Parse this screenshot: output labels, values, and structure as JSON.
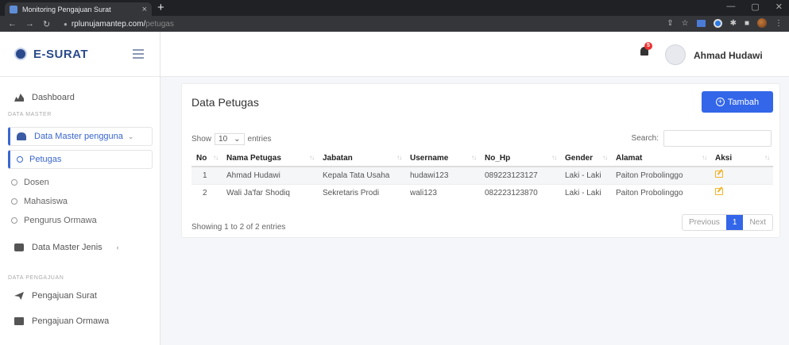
{
  "browser": {
    "tab_title": "Monitoring Pengajuan Surat",
    "tab_close": "×",
    "new_tab": "+",
    "url_domain": "rplunujamantep.com/",
    "url_path": "petugas"
  },
  "header": {
    "brand": "E-SURAT",
    "notification_count": "5",
    "user_name": "Ahmad Hudawi"
  },
  "sidebar": {
    "dashboard": "Dashboard",
    "section_master": "DATA MASTER",
    "master_users": "Data Master pengguna",
    "sub_items": [
      "Petugas",
      "Dosen",
      "Mahasiswa",
      "Pengurus Ormawa"
    ],
    "master_types": "Data Master Jenis",
    "section_submission": "DATA PENGAJUAN",
    "submission_letter": "Pengajuan Surat",
    "submission_ormawa": "Pengajuan Ormawa"
  },
  "card": {
    "title": "Data Petugas",
    "add_button": "Tambah",
    "show_label": "Show",
    "entries_value": "10",
    "entries_label": "entries",
    "search_label": "Search:",
    "columns": [
      "No",
      "Nama Petugas",
      "Jabatan",
      "Username",
      "No_Hp",
      "Gender",
      "Alamat",
      "Aksi"
    ],
    "rows": [
      [
        "1",
        "Ahmad Hudawi",
        "Kepala Tata Usaha",
        "hudawi123",
        "089223123127",
        "Laki - Laki",
        "Paiton Probolinggo"
      ],
      [
        "2",
        "Wali Ja'far Shodiq",
        "Sekretaris Prodi",
        "wali123",
        "082223123870",
        "Laki - Laki",
        "Paiton Probolinggo"
      ]
    ],
    "showing": "Showing 1 to 2 of 2 entries",
    "pager": {
      "previous": "Previous",
      "current": "1",
      "next": "Next"
    }
  },
  "colors": {
    "primary": "#3366e8",
    "brand": "#2a4a8c",
    "edit": "#f0b429",
    "badge": "#e33333"
  }
}
